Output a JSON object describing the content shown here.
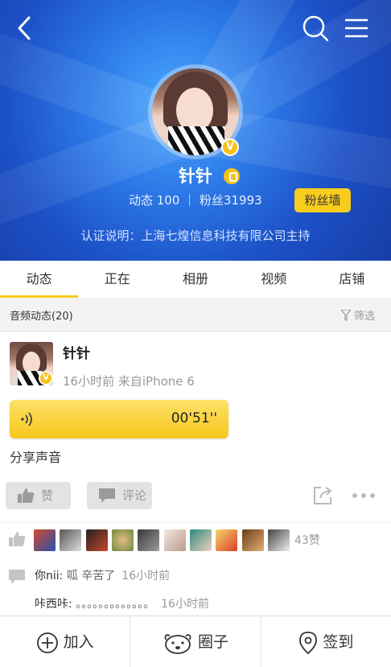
{
  "profile": {
    "name": "针针",
    "stats": "动态 100 ｜ 粉丝31993",
    "fanwall_label": "粉丝墙",
    "certification": "认证说明：上海七煌信息科技有限公司主持",
    "verified_badge": "V"
  },
  "tabs": [
    {
      "label": "动态"
    },
    {
      "label": "正在"
    },
    {
      "label": "相册"
    },
    {
      "label": "视频"
    },
    {
      "label": "店铺"
    }
  ],
  "section": {
    "title": "音频动态(20)",
    "filter_label": "筛选"
  },
  "post": {
    "author": "针针",
    "meta": "16小时前   来自iPhone 6",
    "audio_duration": "00'51''",
    "text": "分享声音",
    "like_label": "赞",
    "comment_label": "评论",
    "like_count": "43赞",
    "comments": [
      {
        "user": "你nii:",
        "text": " 呱 辛苦了",
        "time": "16小时前"
      },
      {
        "user": "咔西咔:",
        "text": " 。。。。。。。。。。。。。",
        "time": "16小时前"
      }
    ]
  },
  "bottom": {
    "join_label": "加入",
    "circle_label": "圈子",
    "checkin_label": "签到"
  },
  "colors": {
    "accent": "#f8cd1d",
    "header_blue": "#2b77e6"
  }
}
